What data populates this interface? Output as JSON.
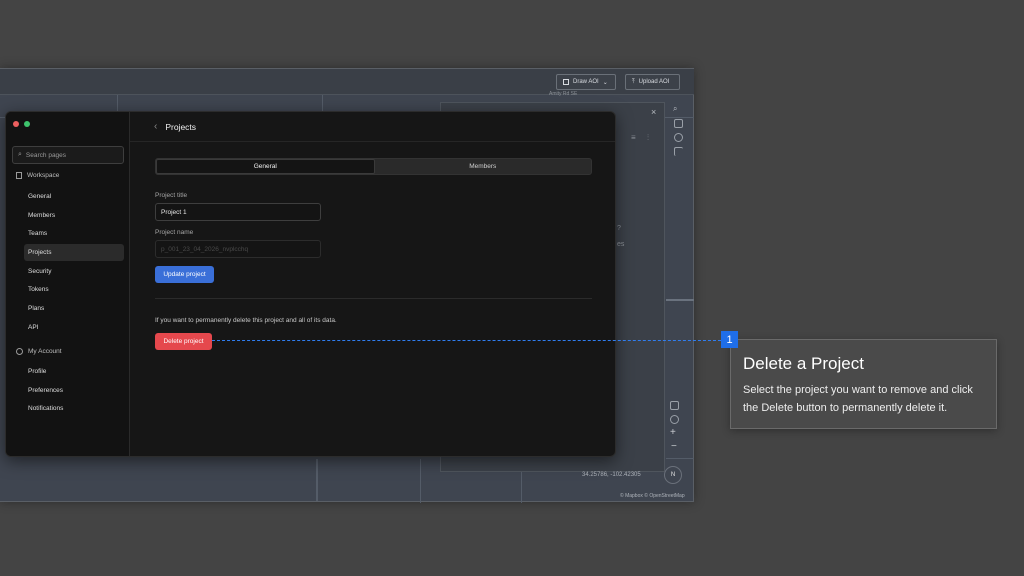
{
  "map": {
    "draw_aoi_label": "Draw AOI",
    "upload_aoi_label": "Upload AOI",
    "coords": "34.25786, -102.42305",
    "attribution": "© Mapbox © OpenStreetMap",
    "compass": "N",
    "place_label": "Amity Rd SE",
    "ghost_texts": [
      "?",
      "es"
    ]
  },
  "sidebar": {
    "search_placeholder": "Search pages",
    "workspace_label": "Workspace",
    "workspace_items": [
      "General",
      "Members",
      "Teams",
      "Projects",
      "Security",
      "Tokens",
      "Plans",
      "API"
    ],
    "account_label": "My Account",
    "account_items": [
      "Profile",
      "Preferences",
      "Notifications"
    ],
    "active_item": "Projects"
  },
  "page": {
    "title": "Projects",
    "tabs": [
      "General",
      "Members"
    ],
    "active_tab": "General",
    "project_title_label": "Project title",
    "project_title_value": "Project 1",
    "project_name_label": "Project name",
    "project_name_value": "p_001_23_04_2026_nvplcchq",
    "update_button": "Update project",
    "delete_note": "If you want to permanently delete this project and all of its data.",
    "delete_button": "Delete project"
  },
  "callout": {
    "step": "1",
    "title": "Delete a Project",
    "body": "Select the project you want to remove and click the Delete button to permanently delete it."
  },
  "colors": {
    "accent_blue": "#3a6fd8",
    "danger_red": "#e5484d",
    "traffic_red": "#ec5f5f",
    "traffic_green": "#3ec46d"
  }
}
